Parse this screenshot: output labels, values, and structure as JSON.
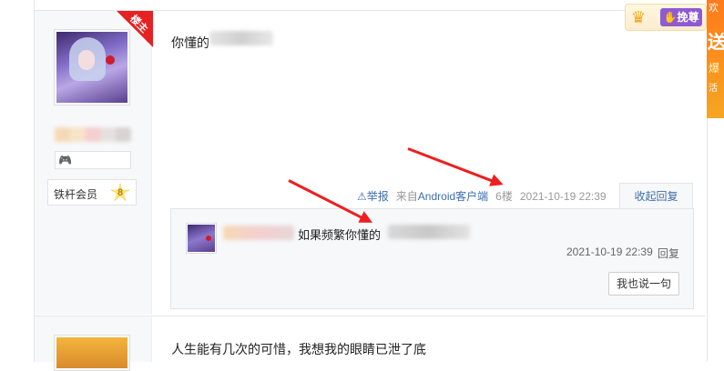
{
  "post1": {
    "op_badge": "楼主",
    "level_title": "铁杆会员",
    "level_number": "8",
    "content_visible": "你懂的",
    "tail": {
      "report": "举报",
      "source_prefix": "来自",
      "source_client": "Android客户端",
      "floor": "6楼",
      "time": "2021-10-19 22:39"
    },
    "collapse_label": "收起回复",
    "sub_reply": {
      "text_visible": "如果频繁你懂的",
      "time": "2021-10-19 22:39",
      "reply_label": "回复"
    },
    "say_button": "我也说一句"
  },
  "post2": {
    "content": "人生能有几次的可惜，我想我的眼睛已泄了底"
  },
  "top_right": {
    "vote_label": "挽尊"
  },
  "side_ad": {
    "t1": "欢",
    "t2": "送",
    "t3": "爆",
    "t4": "活"
  },
  "colors": {
    "link": "#3e6ea9",
    "op_badge": "#e62121",
    "arrow": "#ee1f1f",
    "vote": "#8e5bd1",
    "side_ad": "#ff7a1a"
  },
  "icons": [
    "warning-icon",
    "crown-icon",
    "star-level-icon",
    "hand-icon"
  ]
}
